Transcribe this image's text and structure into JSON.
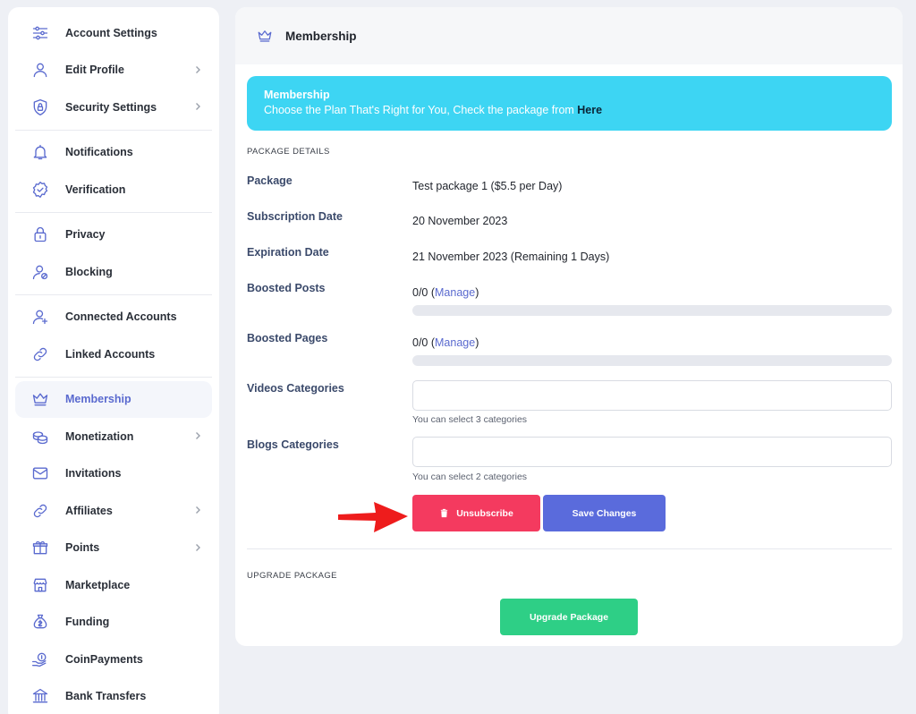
{
  "sidebar": {
    "groups": [
      {
        "items": [
          {
            "label": "Account Settings",
            "icon": "sliders-icon",
            "chevron": false
          },
          {
            "label": "Edit Profile",
            "icon": "user-icon",
            "chevron": true
          },
          {
            "label": "Security Settings",
            "icon": "shield-icon",
            "chevron": true
          }
        ]
      },
      {
        "items": [
          {
            "label": "Notifications",
            "icon": "bell-icon",
            "chevron": false
          },
          {
            "label": "Verification",
            "icon": "badge-check-icon",
            "chevron": false
          }
        ]
      },
      {
        "items": [
          {
            "label": "Privacy",
            "icon": "lock-icon",
            "chevron": false
          },
          {
            "label": "Blocking",
            "icon": "user-block-icon",
            "chevron": false
          }
        ]
      },
      {
        "items": [
          {
            "label": "Connected Accounts",
            "icon": "user-plus-icon",
            "chevron": false
          },
          {
            "label": "Linked Accounts",
            "icon": "link-icon",
            "chevron": false
          }
        ]
      },
      {
        "items": [
          {
            "label": "Membership",
            "icon": "crown-icon",
            "chevron": false,
            "active": true
          },
          {
            "label": "Monetization",
            "icon": "coins-icon",
            "chevron": true
          },
          {
            "label": "Invitations",
            "icon": "envelope-icon",
            "chevron": false
          },
          {
            "label": "Affiliates",
            "icon": "link-icon",
            "chevron": true
          },
          {
            "label": "Points",
            "icon": "gift-icon",
            "chevron": true
          },
          {
            "label": "Marketplace",
            "icon": "store-icon",
            "chevron": false
          },
          {
            "label": "Funding",
            "icon": "money-bag-icon",
            "chevron": false
          },
          {
            "label": "CoinPayments",
            "icon": "coin-hand-icon",
            "chevron": false
          },
          {
            "label": "Bank Transfers",
            "icon": "bank-icon",
            "chevron": false
          }
        ]
      }
    ]
  },
  "header": {
    "title": "Membership",
    "icon": "crown-icon"
  },
  "banner": {
    "title": "Membership",
    "text": "Choose the Plan That's Right for You, Check the package from ",
    "link": "Here",
    "color": "#3dd5f3"
  },
  "package_details": {
    "section_label": "PACKAGE DETAILS",
    "package_label": "Package",
    "package_value": "Test package 1 ($5.5 per Day)",
    "subscription_label": "Subscription Date",
    "subscription_value": "20 November 2023",
    "expiration_label": "Expiration Date",
    "expiration_value": "21 November 2023 (Remaining 1 Days)",
    "boosted_posts_label": "Boosted Posts",
    "boosted_posts_count": "0/0 (",
    "boosted_posts_link": "Manage",
    "boosted_posts_close": ")",
    "boosted_posts_progress": 0,
    "boosted_pages_label": "Boosted Pages",
    "boosted_pages_count": "0/0 (",
    "boosted_pages_link": "Manage",
    "boosted_pages_close": ")",
    "boosted_pages_progress": 0,
    "videos_label": "Videos Categories",
    "videos_value": "",
    "videos_hint": "You can select 3 categories",
    "blogs_label": "Blogs Categories",
    "blogs_value": "",
    "blogs_hint": "You can select 2 categories"
  },
  "actions": {
    "unsubscribe_label": "Unsubscribe",
    "save_label": "Save Changes",
    "unsubscribe_color": "#f43a5f",
    "save_color": "#5a6bdc"
  },
  "upgrade": {
    "section_label": "UPGRADE PACKAGE",
    "button_label": "Upgrade Package",
    "button_color": "#2ecf86"
  }
}
